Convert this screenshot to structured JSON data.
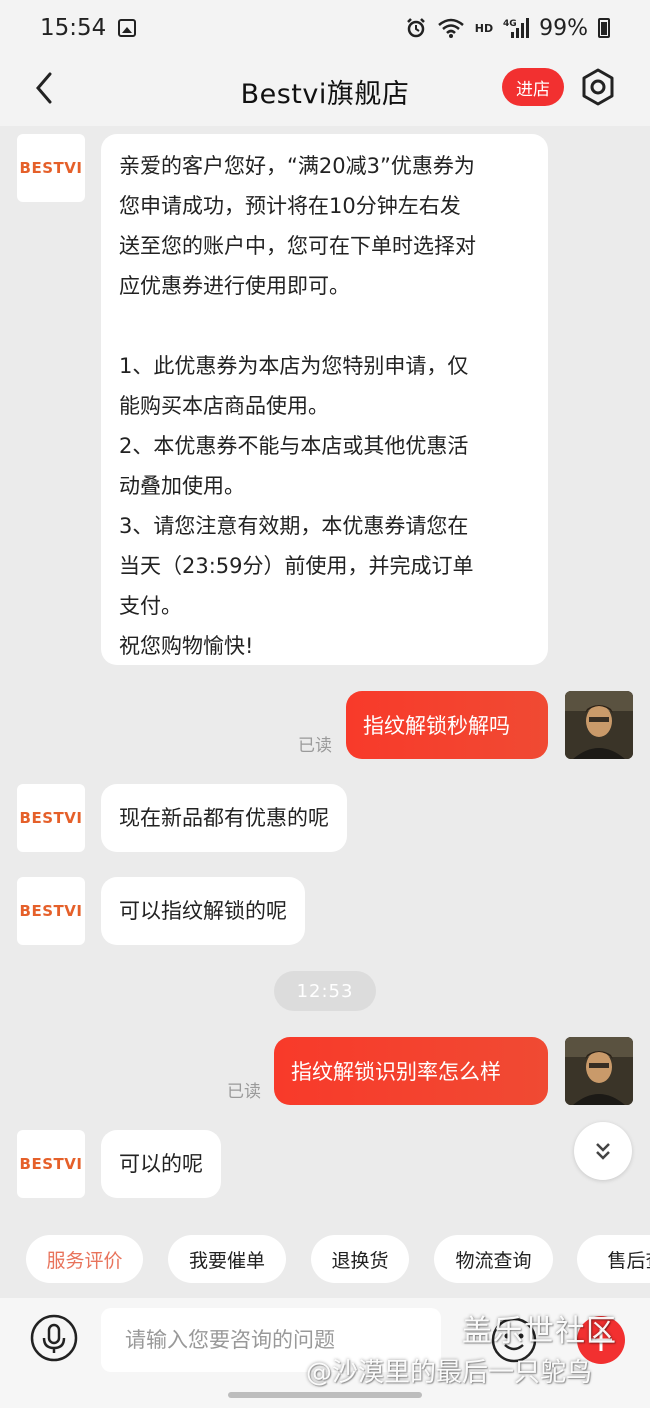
{
  "status_bar": {
    "time": "15:54",
    "network": "4G",
    "hd": "HD",
    "battery": "99%"
  },
  "header": {
    "title": "Bestvi旗舰店",
    "enter_store_label": "进店"
  },
  "shop_avatar_text": "BESTVI",
  "messages": [
    {
      "from": "shop",
      "lines": [
        "亲爱的客户您好，“满20减3”优惠券为",
        "您申请成功，预计将在10分钟左右发",
        "送至您的账户中，您可在下单时选择对",
        "应优惠券进行使用即可。",
        "",
        "1、此优惠券为本店为您特别申请，仅",
        "能购买本店商品使用。",
        "2、本优惠券不能与本店或其他优惠活",
        "动叠加使用。",
        "3、请您注意有效期，本优惠券请您在",
        "当天（23:59分）前使用，并完成订单",
        "支付。",
        "祝您购物愉快!"
      ]
    },
    {
      "from": "user",
      "text": "指纹解锁秒解吗",
      "read": "已读"
    },
    {
      "from": "shop",
      "text": "现在新品都有优惠的呢"
    },
    {
      "from": "shop",
      "text": "可以指纹解锁的呢"
    },
    {
      "from": "timestamp",
      "text": "12:53"
    },
    {
      "from": "user",
      "text": "指纹解锁识别率怎么样",
      "read": "已读"
    },
    {
      "from": "shop",
      "text": "可以的呢"
    }
  ],
  "quick_replies": [
    "服务评价",
    "我要催单",
    "退换货",
    "物流查询",
    "售后查"
  ],
  "input": {
    "placeholder": "请输入您要咨询的问题"
  },
  "watermark": {
    "line1": "盖乐世社区",
    "line2": "@沙漠里的最后一只鸵鸟"
  },
  "colors": {
    "accent": "#f23030",
    "bubble_out": "#f5412f",
    "brand_logo": "#e5602a",
    "background": "#ebebeb"
  }
}
